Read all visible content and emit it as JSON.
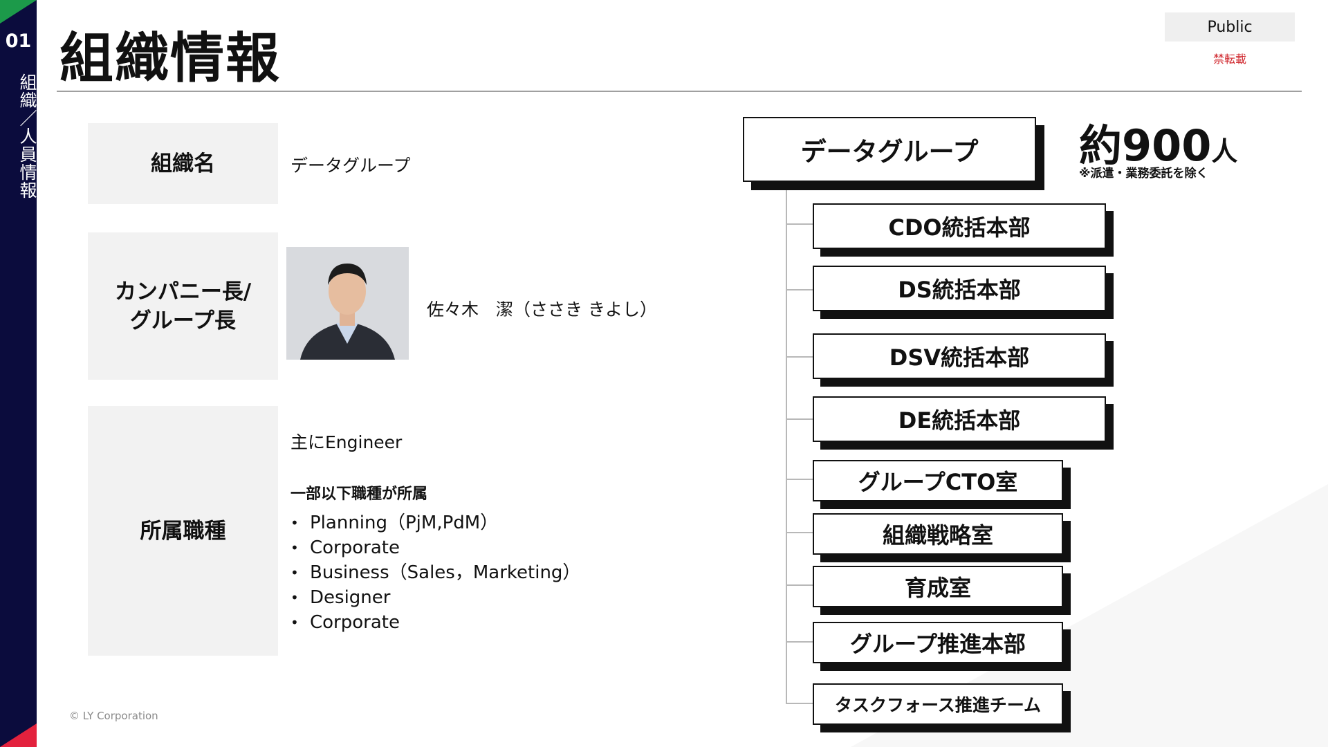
{
  "sidebar": {
    "section_number": "01",
    "section_label": "組織／人員情報"
  },
  "header": {
    "title": "組織情報",
    "classification": "Public",
    "notice": "禁転載"
  },
  "rows": {
    "org_name": {
      "label": "組織名",
      "value": "データグループ"
    },
    "leader": {
      "label_line1": "カンパニー長/",
      "label_line2": "グループ長",
      "name": "佐々木　潔（ささき きよし）"
    },
    "jobs": {
      "label": "所属職種",
      "lead": "主にEngineer",
      "sub": "一部以下職種が所属",
      "items": [
        "Planning（PjM,PdM）",
        "Corporate",
        "Business（Sales，Marketing）",
        "Designer",
        "Corporate"
      ]
    }
  },
  "org_chart": {
    "root": "データグループ",
    "headcount_number": "約900",
    "headcount_unit": "人",
    "headcount_note": "※派遣・業務委託を除く",
    "children": [
      "CDO統括本部",
      "DS統括本部",
      "DSV統括本部",
      "DE統括本部",
      "グループCTO室",
      "組織戦略室",
      "育成室",
      "グループ推進本部",
      "タスクフォース推進チーム"
    ]
  },
  "footer": {
    "copyright": "© LY Corporation"
  }
}
